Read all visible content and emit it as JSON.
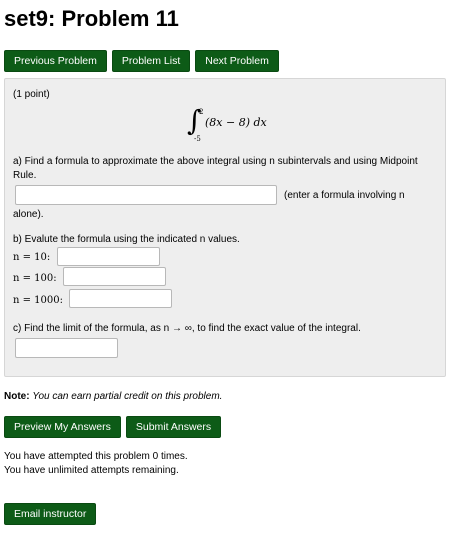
{
  "page": {
    "title": "set9: Problem 11"
  },
  "nav": {
    "previous": "Previous Problem",
    "list": "Problem List",
    "next": "Next Problem"
  },
  "problem": {
    "points": "(1 point)",
    "integral": {
      "upper": "2",
      "lower": "-5",
      "integrand": "(8x − 8) dx"
    },
    "part_a": {
      "text_line1": "a) Find a formula to approximate the above integral using n subintervals and using Midpoint",
      "text_line2": "Rule.",
      "hint": "(enter a formula involving n",
      "hint_cont": "alone).",
      "value": ""
    },
    "part_b": {
      "text": "b) Evalute the formula using the indicated n values.",
      "rows": [
        {
          "label": "n = 10:",
          "value": ""
        },
        {
          "label": "n = 100:",
          "value": ""
        },
        {
          "label": "n = 1000:",
          "value": ""
        }
      ]
    },
    "part_c": {
      "text": "c) Find the limit of the formula, as n → ∞, to find the exact value of the integral.",
      "value": ""
    }
  },
  "note": {
    "label": "Note:",
    "text": "You can earn partial credit on this problem."
  },
  "actions": {
    "preview": "Preview My Answers",
    "submit": "Submit Answers"
  },
  "status": {
    "attempts": "You have attempted this problem 0 times.",
    "remaining": "You have unlimited attempts remaining."
  },
  "email": {
    "label": "Email instructor"
  },
  "colors": {
    "button": "#0d5b17",
    "panel": "#eeeeee"
  }
}
